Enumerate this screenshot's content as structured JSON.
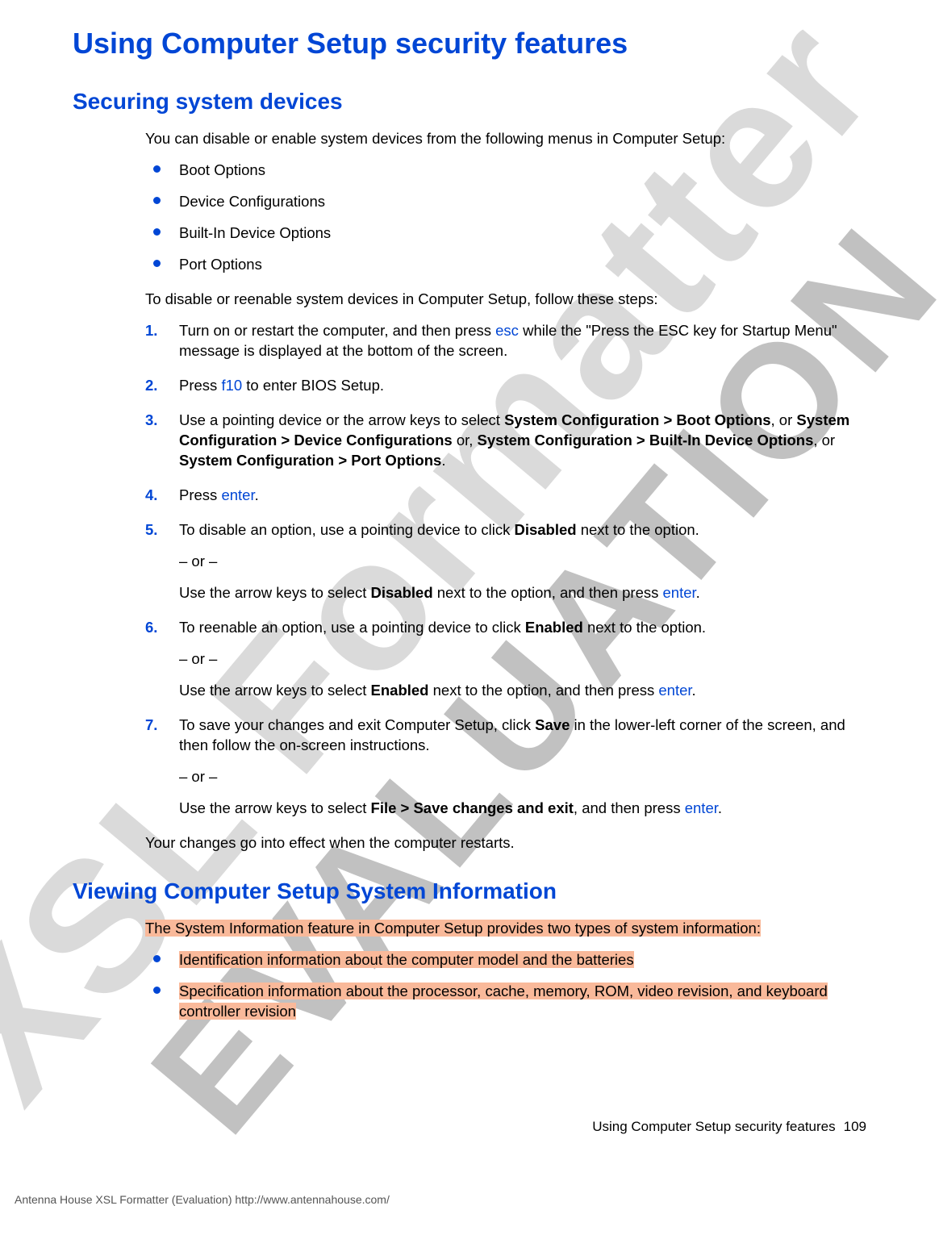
{
  "watermark": {
    "line1": "XSL Formatter",
    "line2": "EVALUATION"
  },
  "h1": "Using Computer Setup security features",
  "section1": {
    "heading": "Securing system devices",
    "intro": "You can disable or enable system devices from the following menus in Computer Setup:",
    "bullets": [
      "Boot Options",
      "Device Configurations",
      "Built-In Device Options",
      "Port Options"
    ],
    "para2": "To disable or reenable system devices in Computer Setup, follow these steps:",
    "steps": {
      "s1a": "Turn on or restart the computer, and then press ",
      "s1_kbd": "esc",
      "s1b": " while the \"Press the ESC key for Startup Menu\" message is displayed at the bottom of the screen.",
      "s2a": "Press ",
      "s2_kbd": "f10",
      "s2b": " to enter BIOS Setup.",
      "s3a": "Use a pointing device or the arrow keys to select ",
      "s3_b1": "System Configuration > Boot Options",
      "s3_mid1": ", or ",
      "s3_b2": "System Configuration > Device Configurations",
      "s3_mid2": " or, ",
      "s3_b3": "System Configuration > Built-In Device Options",
      "s3_mid3": ", or ",
      "s3_b4": "System Configuration > Port Options",
      "s3_end": ".",
      "s4a": "Press ",
      "s4_kbd": "enter",
      "s4b": ".",
      "s5a": "To disable an option, use a pointing device to click ",
      "s5_b": "Disabled",
      "s5b": " next to the option.",
      "or": "– or –",
      "s5c": "Use the arrow keys to select ",
      "s5_b2": "Disabled",
      "s5d": " next to the option, and then press ",
      "s5_kbd": "enter",
      "s5e": ".",
      "s6a": "To reenable an option, use a pointing device to click ",
      "s6_b": "Enabled",
      "s6b": " next to the option.",
      "s6c": "Use the arrow keys to select ",
      "s6_b2": "Enabled",
      "s6d": " next to the option, and then press ",
      "s6_kbd": "enter",
      "s6e": ".",
      "s7a": "To save your changes and exit Computer Setup, click ",
      "s7_b": "Save",
      "s7b": " in the lower-left corner of the screen, and then follow the on-screen instructions.",
      "s7c": "Use the arrow keys to select ",
      "s7_b2": "File > Save changes and exit",
      "s7d": ", and then press ",
      "s7_kbd": "enter",
      "s7e": "."
    },
    "outro": "Your changes go into effect when the computer restarts."
  },
  "section2": {
    "heading": "Viewing Computer Setup System Information",
    "intro": "The System Information feature in Computer Setup provides two types of system information:",
    "bullets": [
      "Identification information about the computer model and the batteries",
      "Specification information about the processor, cache, memory, ROM, video revision, and keyboard controller revision"
    ]
  },
  "footer": {
    "right_text": "Using Computer Setup security features",
    "page_number": "109",
    "left_text": "Antenna House XSL Formatter (Evaluation)  http://www.antennahouse.com/"
  }
}
